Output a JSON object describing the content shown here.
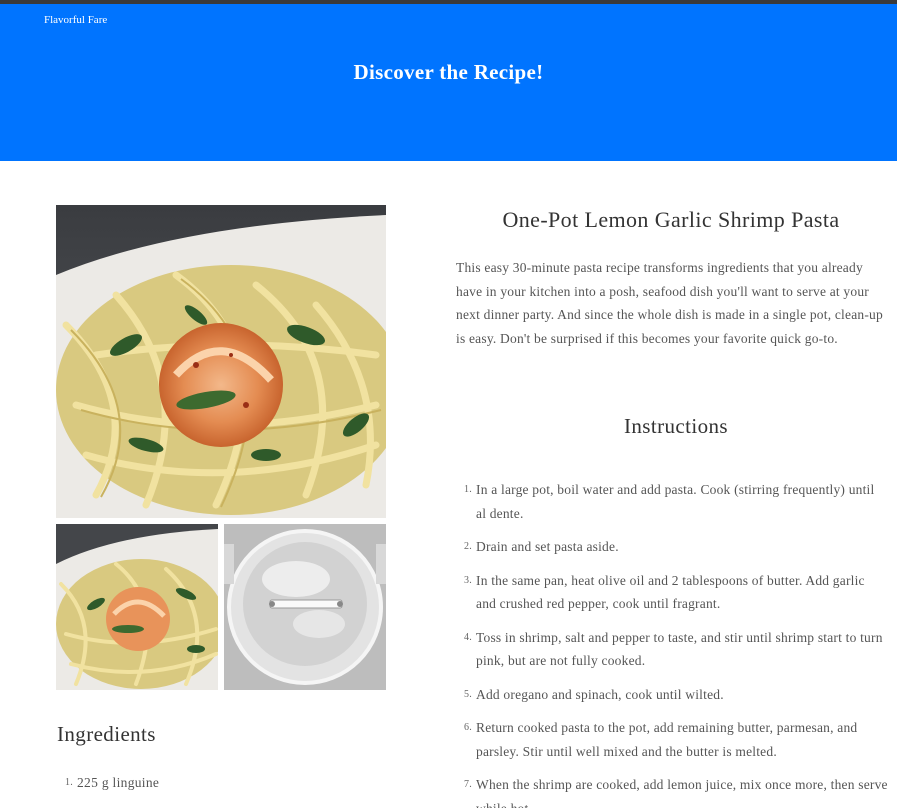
{
  "site": {
    "brand": "Flavorful Fare",
    "hero_title": "Discover the Recipe!"
  },
  "colors": {
    "hero_bg": "#0074ff",
    "text": "#555555",
    "heading": "#333333"
  },
  "images": {
    "main": "shrimp-pasta-photo",
    "thumb_1": "shrimp-pasta-photo",
    "thumb_2": "boiling-pot-photo"
  },
  "recipe": {
    "title": "One-Pot Lemon Garlic Shrimp Pasta",
    "description": "This easy 30-minute pasta recipe transforms ingredients that you already have in your kitchen into a posh, seafood dish you'll want to serve at your next dinner party. And since the whole dish is made in a single pot, clean-up is easy. Don't be surprised if this becomes your favorite quick go-to."
  },
  "instructions": {
    "heading": "Instructions",
    "steps": [
      {
        "num": "1.",
        "text": "In a large pot, boil water and add pasta. Cook (stirring frequently) until al dente."
      },
      {
        "num": "2.",
        "text": "Drain and set pasta aside."
      },
      {
        "num": "3.",
        "text": "In the same pan, heat olive oil and 2 tablespoons of butter. Add garlic and crushed red pepper, cook until fragrant."
      },
      {
        "num": "4.",
        "text": "Toss in shrimp, salt and pepper to taste, and stir until shrimp start to turn pink, but are not fully cooked."
      },
      {
        "num": "5.",
        "text": "Add oregano and spinach, cook until wilted."
      },
      {
        "num": "6.",
        "text": "Return cooked pasta to the pot, add remaining butter, parmesan, and parsley. Stir until well mixed and the butter is melted."
      },
      {
        "num": "7.",
        "text": "When the shrimp are cooked, add lemon juice, mix once more, then serve while hot."
      }
    ]
  },
  "ingredients": {
    "heading": "Ingredients",
    "items": [
      {
        "num": "1.",
        "text": "225 g linguine"
      }
    ]
  }
}
